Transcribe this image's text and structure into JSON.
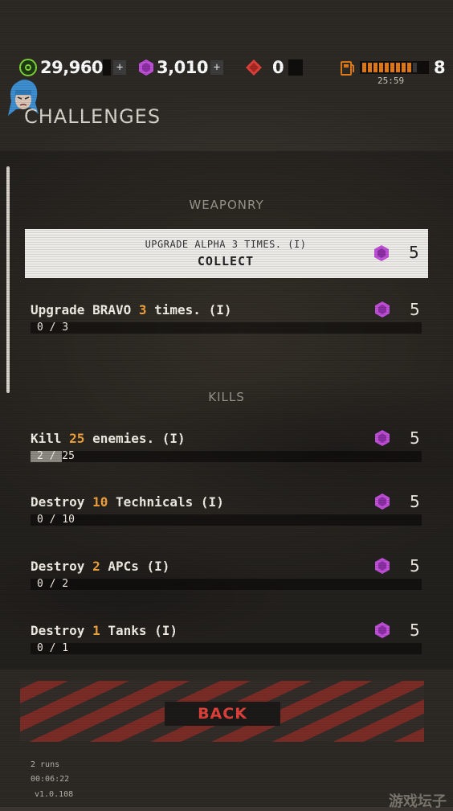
{
  "resources": {
    "coins": "29,960",
    "gems": "3,010",
    "red": "0",
    "fuel_count": "8",
    "fuel_timer": "25:59",
    "fuel_level": 0.9,
    "plus_label": "+"
  },
  "page_title": "CHALLENGES",
  "sections": {
    "weaponry": "WEAPONRY",
    "kills": "KILLS"
  },
  "collect_card": {
    "description": "UPGRADE ALPHA 3 TIMES. (I)",
    "label": "COLLECT",
    "reward": "5"
  },
  "challenges": [
    {
      "pre": "Upgrade BRAVO ",
      "hl": "3",
      "post": " times. (I)",
      "progress": "0 / 3",
      "fraction": 0,
      "reward": "5"
    },
    {
      "pre": "Kill ",
      "hl": "25",
      "post": " enemies. (I)",
      "progress": "2 / 25",
      "fraction": 0.08,
      "reward": "5"
    },
    {
      "pre": "Destroy ",
      "hl": "10",
      "post": " Technicals (I)",
      "progress": "0 / 10",
      "fraction": 0,
      "reward": "5"
    },
    {
      "pre": "Destroy ",
      "hl": "2",
      "post": " APCs (I)",
      "progress": "0 / 2",
      "fraction": 0,
      "reward": "5"
    },
    {
      "pre": "Destroy ",
      "hl": "1",
      "post": " Tanks (I)",
      "progress": "0 / 1",
      "fraction": 0,
      "reward": "5"
    }
  ],
  "back_label": "BACK",
  "footer": {
    "runs": "2 runs",
    "time": "00:06:22",
    "version": "v1.0.108"
  },
  "watermark": "游戏坛子",
  "colors": {
    "coin": "#7fd43a",
    "gem": "#c04fd8",
    "red_gem": "#e0413a",
    "fuel": "#e07a1a",
    "highlight": "#f2a23c",
    "back_text": "#e0413a"
  }
}
